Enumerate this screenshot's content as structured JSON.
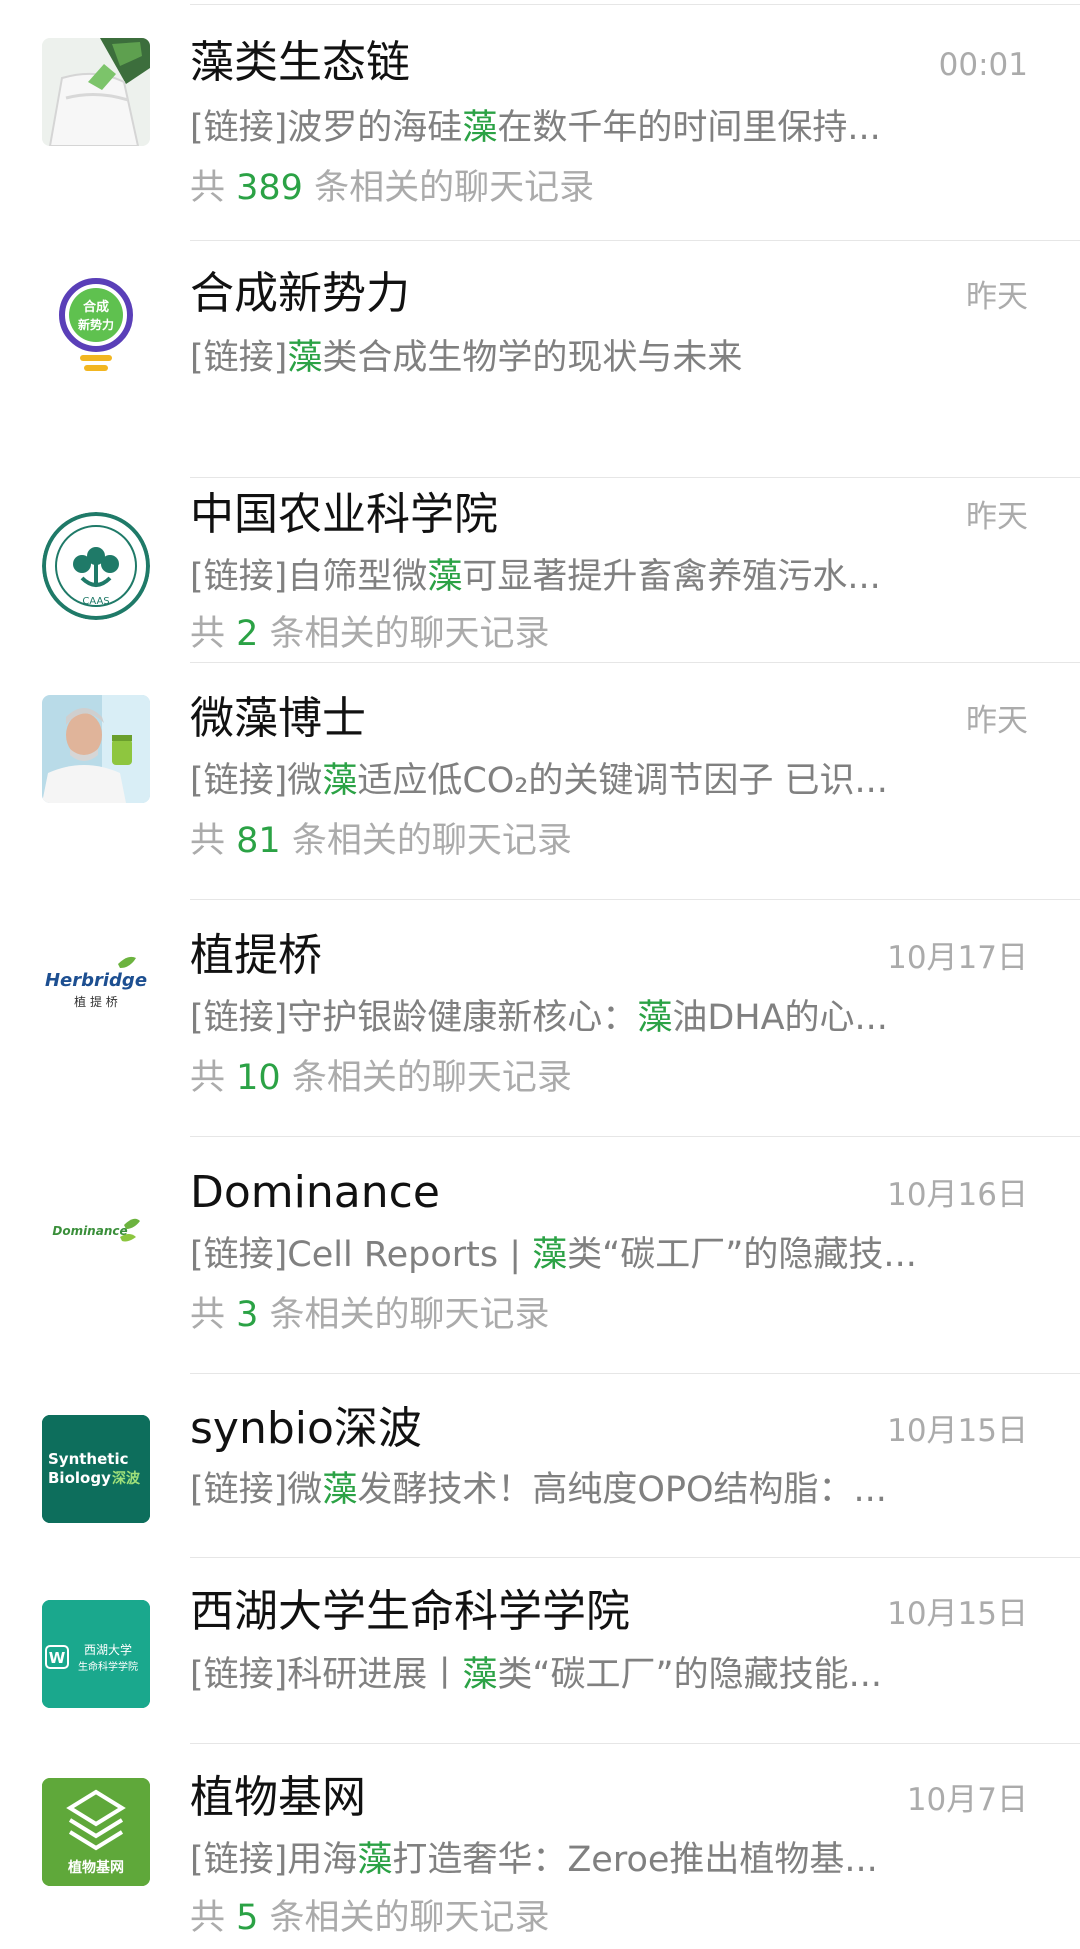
{
  "results": [
    {
      "name": "藻类生态链",
      "time": "00:01",
      "snippet_prefix": "[链接]波罗的海硅",
      "keyword": "藻",
      "snippet_suffix": "在数千年的时间里保持...",
      "count_prefix": "共 ",
      "count": "389",
      "count_suffix": " 条相关的聊天记录",
      "avatar_icon": "bottle-logo-icon"
    },
    {
      "name": "合成新势力",
      "time": "昨天",
      "snippet_prefix": "[链接]",
      "keyword": "藻",
      "snippet_suffix": "类合成生物学的现状与未来",
      "avatar_icon": "lightbulb-logo-icon",
      "avatar_text_1": "合成",
      "avatar_text_2": "新势力"
    },
    {
      "name": "中国农业科学院",
      "time": "昨天",
      "snippet_prefix": "[链接]自筛型微",
      "keyword": "藻",
      "snippet_suffix": "可显著提升畜禽养殖污水...",
      "count_prefix": "共 ",
      "count": "2",
      "count_suffix": " 条相关的聊天记录",
      "avatar_icon": "caas-seal-icon",
      "avatar_text_1": "CAAS"
    },
    {
      "name": "微藻博士",
      "time": "昨天",
      "snippet_prefix": "[链接]微",
      "keyword": "藻",
      "snippet_suffix": "适应低CO₂的关键调节因子 已识...",
      "count_prefix": "共 ",
      "count": "81",
      "count_suffix": " 条相关的聊天记录",
      "avatar_icon": "scientist-photo-icon"
    },
    {
      "name": "植提桥",
      "time": "10月17日",
      "snippet_prefix": "[链接]守护银龄健康新核心：",
      "keyword": "藻",
      "snippet_suffix": "油DHA的心...",
      "count_prefix": "共 ",
      "count": "10",
      "count_suffix": " 条相关的聊天记录",
      "avatar_icon": "herbridge-logo-icon",
      "avatar_text_1": "Herbridge",
      "avatar_text_2": "植 提 桥"
    },
    {
      "name": "Dominance",
      "time": "10月16日",
      "snippet_prefix": "[链接]Cell Reports | ",
      "keyword": "藻",
      "snippet_suffix": "类“碳工厂”的隐藏技...",
      "count_prefix": "共 ",
      "count": "3",
      "count_suffix": " 条相关的聊天记录",
      "avatar_icon": "dominance-logo-icon",
      "avatar_text_1": "Dominance"
    },
    {
      "name": "synbio深波",
      "time": "10月15日",
      "snippet_prefix": "[链接]微",
      "keyword": "藻",
      "snippet_suffix": "发酵技术！高纯度OPO结构脂：...",
      "avatar_icon": "synbio-logo-icon",
      "avatar_text_1": "Synthetic",
      "avatar_text_2": "Biology",
      "avatar_text_3": "深波"
    },
    {
      "name": "西湖大学生命科学学院",
      "time": "10月15日",
      "snippet_prefix": "[链接]科研进展丨",
      "keyword": "藻",
      "snippet_suffix": "类“碳工厂”的隐藏技能...",
      "avatar_icon": "westlake-logo-icon",
      "avatar_text_1": "西湖大学",
      "avatar_text_2": "生命科学学院"
    },
    {
      "name": "植物基网",
      "time": "10月7日",
      "snippet_prefix": "[链接]用海",
      "keyword": "藻",
      "snippet_suffix": "打造奢华：Zeroe推出植物基...",
      "count_prefix": "共 ",
      "count": "5",
      "count_suffix": " 条相关的聊天记录",
      "avatar_icon": "plant-base-logo-icon",
      "avatar_text_1": "植物基网"
    }
  ],
  "colors": {
    "keyword": "#2ba245",
    "title": "#111111",
    "snippet": "#808080",
    "meta": "#ababab"
  }
}
